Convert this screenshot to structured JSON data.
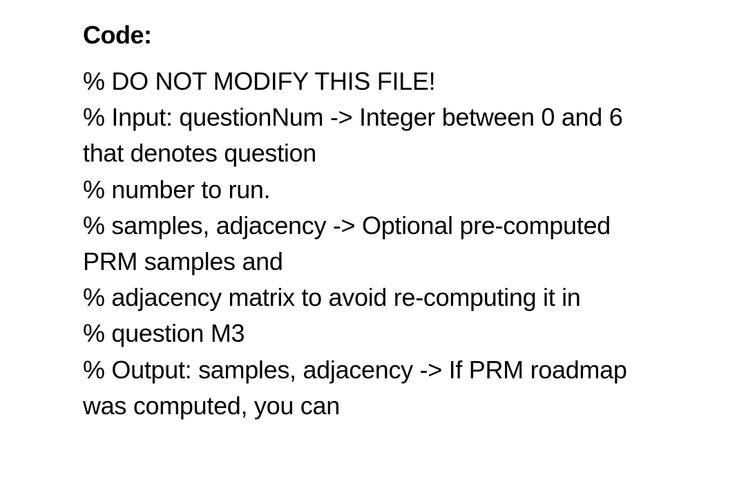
{
  "heading": "Code:",
  "lines": [
    "% DO NOT MODIFY THIS FILE!",
    "% Input: questionNum -> Integer between 0 and 6 that denotes question",
    "% number to run.",
    "% samples, adjacency -> Optional pre-computed PRM samples and",
    "% adjacency matrix to avoid re-computing it in",
    "% question M3",
    "% Output: samples, adjacency -> If PRM roadmap was computed, you can"
  ]
}
